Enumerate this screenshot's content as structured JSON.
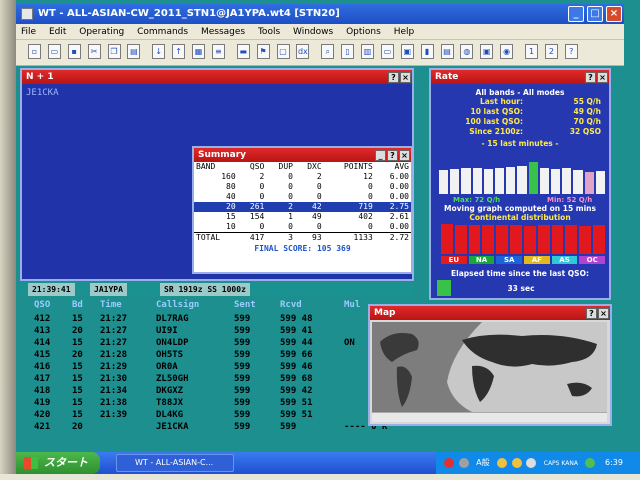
{
  "window": {
    "title": "WT - ALL-ASIAN-CW_2011_STN1@JA1YPA.wt4 [STN20]",
    "min": "_",
    "max": "□",
    "close": "×"
  },
  "menu": [
    "File",
    "Edit",
    "Operating",
    "Commands",
    "Messages",
    "Tools",
    "Windows",
    "Options",
    "Help"
  ],
  "n1": {
    "title": "N + 1",
    "entry": "JE1CKA"
  },
  "rate": {
    "title": "Rate",
    "header": "All bands - All modes",
    "rows": [
      {
        "k": "Last hour:",
        "v": "55 Q/h"
      },
      {
        "k": "10 last QSO:",
        "v": "49 Q/h"
      },
      {
        "k": "100 last QSO:",
        "v": "70 Q/h"
      },
      {
        "k": "Since 2100z:",
        "v": "32 QSO"
      }
    ],
    "last15_label": "- 15 last minutes -",
    "bars15": [
      0.75,
      0.78,
      0.8,
      0.82,
      0.78,
      0.8,
      0.83,
      0.86,
      1.0,
      0.8,
      0.78,
      0.82,
      0.74,
      0.7,
      0.72
    ],
    "max_label": "Max: 72 Q/h",
    "min_label": "Min: 52 Q/h",
    "moving_label": "Moving graph computed on 15 mins",
    "continental_label": "Continental distribution",
    "cont_bars": [
      1.0,
      0.98,
      0.97,
      0.98,
      0.96,
      0.97,
      0.95,
      0.96,
      0.97,
      0.96,
      0.95,
      0.96
    ],
    "legend": [
      {
        "label": "EU",
        "color": "#e51a1a"
      },
      {
        "label": "NA",
        "color": "#18a83a"
      },
      {
        "label": "SA",
        "color": "#1f64d6"
      },
      {
        "label": "AF",
        "color": "#e3b81c"
      },
      {
        "label": "AS",
        "color": "#2fc8d8"
      },
      {
        "label": "OC",
        "color": "#b044d0"
      }
    ],
    "elapsed_label": "Elapsed time since the last QSO:",
    "elapsed_value": "33 sec"
  },
  "summary": {
    "title": "Summary",
    "headers": [
      "BAND",
      "QSO",
      "DUP",
      "DXC",
      "POINTS",
      "AVG"
    ],
    "rows": [
      [
        "160",
        "2",
        "0",
        "2",
        "12",
        "6.00"
      ],
      [
        "80",
        "0",
        "0",
        "0",
        "0",
        "0.00"
      ],
      [
        "40",
        "0",
        "0",
        "0",
        "0",
        "0.00"
      ],
      [
        "20",
        "261",
        "2",
        "42",
        "719",
        "2.75"
      ],
      [
        "15",
        "154",
        "1",
        "49",
        "402",
        "2.61"
      ],
      [
        "10",
        "0",
        "0",
        "0",
        "0",
        "0.00"
      ]
    ],
    "total": [
      "TOTAL",
      "417",
      "3",
      "93",
      "1133",
      "2.72"
    ],
    "final": "FINAL SCORE: 105 369"
  },
  "status": {
    "time": "21:39:41",
    "call": "JA1YPA",
    "sr": "SR 1919z SS 1000z"
  },
  "log": {
    "headers": [
      "QSO",
      "Bd",
      "Time",
      "Callsign",
      "Sent",
      "Rcvd",
      "Mul"
    ],
    "rows": [
      [
        "412",
        "15",
        "21:27",
        "DL7RAG",
        "599",
        "599 48",
        ""
      ],
      [
        "413",
        "20",
        "21:27",
        "UI9I",
        "599",
        "599 41",
        ""
      ],
      [
        "414",
        "15",
        "21:27",
        "ON4LDP",
        "599",
        "599 44",
        "ON"
      ],
      [
        "415",
        "20",
        "21:28",
        "OH5TS",
        "599",
        "599 66",
        ""
      ],
      [
        "416",
        "15",
        "21:29",
        "OR0A",
        "599",
        "599 46",
        ""
      ],
      [
        "417",
        "15",
        "21:30",
        "ZL50GH",
        "599",
        "599 68",
        ""
      ],
      [
        "418",
        "15",
        "21:34",
        "DKGXZ",
        "599",
        "599 42",
        ""
      ],
      [
        "419",
        "15",
        "21:38",
        "T88JX",
        "599",
        "599 51",
        ""
      ],
      [
        "420",
        "15",
        "21:39",
        "DL4KG",
        "599",
        "599 51",
        ""
      ],
      [
        "421",
        "20",
        "",
        "JE1CKA",
        "599",
        "599",
        "----   0 R"
      ]
    ]
  },
  "map": {
    "title": "Map"
  },
  "taskbar": {
    "start": "スタート",
    "item": "WT - ALL-ASIAN-C...",
    "ime": "A般",
    "caps": "CAPS KANA",
    "clock": "6:39"
  }
}
